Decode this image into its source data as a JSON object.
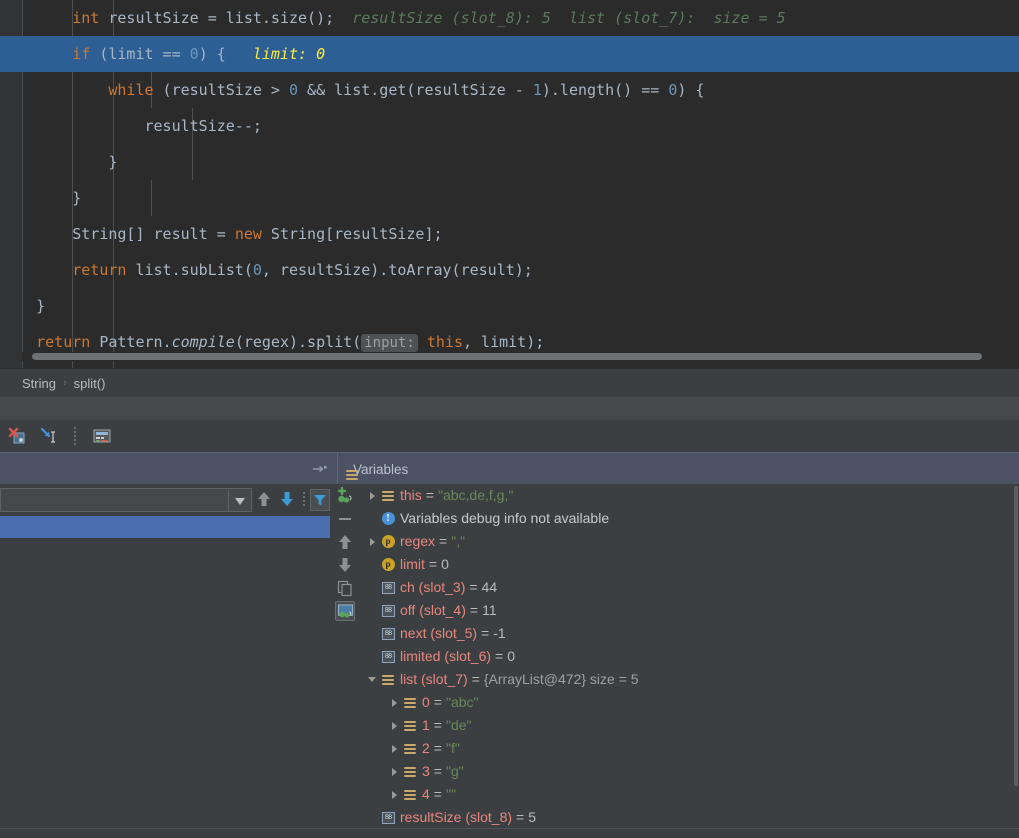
{
  "editor": {
    "lines": [
      {
        "indent": 0,
        "highlighted": false,
        "tokens": [
          {
            "t": "        ",
            "c": "plain"
          },
          {
            "t": "int",
            "c": "kw"
          },
          {
            "t": " resultSize = list.size();",
            "c": "plain"
          },
          {
            "t": "  resultSize (slot_8): 5  list (slot_7):  size = 5",
            "c": "hint-green"
          }
        ]
      },
      {
        "indent": 0,
        "highlighted": true,
        "tokens": [
          {
            "t": "        ",
            "c": "plain"
          },
          {
            "t": "if",
            "c": "kw"
          },
          {
            "t": " (limit == ",
            "c": "plain"
          },
          {
            "t": "0",
            "c": "num"
          },
          {
            "t": ") {",
            "c": "plain"
          },
          {
            "t": "   limit: 0",
            "c": "hint-yellow"
          }
        ]
      },
      {
        "indent": 0,
        "highlighted": false,
        "tokens": [
          {
            "t": "            ",
            "c": "plain"
          },
          {
            "t": "while",
            "c": "kw"
          },
          {
            "t": " (resultSize > ",
            "c": "plain"
          },
          {
            "t": "0",
            "c": "num"
          },
          {
            "t": " && list.get(resultSize - ",
            "c": "plain"
          },
          {
            "t": "1",
            "c": "num"
          },
          {
            "t": ").length() == ",
            "c": "plain"
          },
          {
            "t": "0",
            "c": "num"
          },
          {
            "t": ") {",
            "c": "plain"
          }
        ]
      },
      {
        "indent": 0,
        "highlighted": false,
        "tokens": [
          {
            "t": "                resultSize--;",
            "c": "plain"
          }
        ]
      },
      {
        "indent": 0,
        "highlighted": false,
        "tokens": [
          {
            "t": "            }",
            "c": "plain"
          }
        ]
      },
      {
        "indent": 0,
        "highlighted": false,
        "tokens": [
          {
            "t": "        }",
            "c": "plain"
          }
        ]
      },
      {
        "indent": 0,
        "highlighted": false,
        "tokens": [
          {
            "t": "        String[] result = ",
            "c": "plain"
          },
          {
            "t": "new",
            "c": "kw"
          },
          {
            "t": " String[resultSize];",
            "c": "plain"
          }
        ]
      },
      {
        "indent": 0,
        "highlighted": false,
        "tokens": [
          {
            "t": "        ",
            "c": "plain"
          },
          {
            "t": "return",
            "c": "kw"
          },
          {
            "t": " list.subList(",
            "c": "plain"
          },
          {
            "t": "0",
            "c": "num"
          },
          {
            "t": ", resultSize).toArray(result);",
            "c": "plain"
          }
        ]
      },
      {
        "indent": 0,
        "highlighted": false,
        "tokens": [
          {
            "t": "    }",
            "c": "plain"
          }
        ]
      },
      {
        "indent": 0,
        "highlighted": false,
        "tokens": [
          {
            "t": "    ",
            "c": "plain"
          },
          {
            "t": "return",
            "c": "kw"
          },
          {
            "t": " Pattern.",
            "c": "plain"
          },
          {
            "t": "compile",
            "c": "ital"
          },
          {
            "t": "(regex).split(",
            "c": "plain"
          },
          {
            "t": "input:",
            "c": "pchip"
          },
          {
            "t": " ",
            "c": "plain"
          },
          {
            "t": "this",
            "c": "kw"
          },
          {
            "t": ", limit);",
            "c": "plain"
          }
        ]
      }
    ]
  },
  "breadcrumb": {
    "items": [
      "String",
      "split()"
    ],
    "separator": "›"
  },
  "debug_toolbar": {
    "icons": [
      {
        "name": "mute-breakpoints-icon",
        "title": "Mute Breakpoints"
      },
      {
        "name": "run-to-cursor-icon",
        "title": "Run to Cursor"
      },
      {
        "name": "evaluate-expression-icon",
        "title": "Evaluate Expression"
      }
    ]
  },
  "variables_panel": {
    "tab_label": "Variables",
    "tab_icon": "variables-list-icon",
    "pin_icon": "settings-arrow-icon"
  },
  "left_panel": {
    "combo_value": "",
    "combo_placeholder": "",
    "nav_icons": [
      {
        "name": "nav-up-icon"
      },
      {
        "name": "nav-down-icon"
      },
      {
        "name": "filter-icon",
        "selected": true
      }
    ]
  },
  "vertical_strip": {
    "icons": [
      {
        "name": "add-watch-icon",
        "selected": false
      },
      {
        "name": "remove-watch-icon",
        "selected": false
      },
      {
        "name": "move-up-icon",
        "selected": false
      },
      {
        "name": "move-down-icon",
        "selected": false
      },
      {
        "name": "copy-icon",
        "selected": false
      },
      {
        "name": "watches-toggle-icon",
        "selected": true
      }
    ]
  },
  "variables_tree": [
    {
      "indent": 0,
      "expander": "right",
      "icon": "list-icon",
      "name": "this",
      "eq": "=",
      "value": "\"abc,de,f,g,\"",
      "value_kind": "string"
    },
    {
      "indent": 0,
      "expander": "none",
      "icon": "warning-icon",
      "name": "",
      "eq": "",
      "value": "Variables debug info not available",
      "value_kind": "warning"
    },
    {
      "indent": 0,
      "expander": "right",
      "icon": "param-icon",
      "name": "regex",
      "eq": "=",
      "value": "\",\"",
      "value_kind": "string"
    },
    {
      "indent": 0,
      "expander": "none",
      "icon": "param-icon",
      "name": "limit",
      "eq": "=",
      "value": "0",
      "value_kind": "number"
    },
    {
      "indent": 0,
      "expander": "none",
      "icon": "primitive-icon",
      "name": "ch (slot_3)",
      "eq": "=",
      "value": "44",
      "value_kind": "number"
    },
    {
      "indent": 0,
      "expander": "none",
      "icon": "primitive-icon",
      "name": "off (slot_4)",
      "eq": "=",
      "value": "11",
      "value_kind": "number"
    },
    {
      "indent": 0,
      "expander": "none",
      "icon": "primitive-icon",
      "name": "next (slot_5)",
      "eq": "=",
      "value": "-1",
      "value_kind": "number"
    },
    {
      "indent": 0,
      "expander": "none",
      "icon": "primitive-icon",
      "name": "limited (slot_6)",
      "eq": "=",
      "value": "0",
      "value_kind": "number"
    },
    {
      "indent": 0,
      "expander": "down",
      "icon": "list-icon",
      "name": "list (slot_7)",
      "eq": "=",
      "value": "{ArrayList@472}  size = 5",
      "value_kind": "object"
    },
    {
      "indent": 1,
      "expander": "right",
      "icon": "list-icon",
      "name": "0",
      "eq": "=",
      "value": "\"abc\"",
      "value_kind": "string"
    },
    {
      "indent": 1,
      "expander": "right",
      "icon": "list-icon",
      "name": "1",
      "eq": "=",
      "value": "\"de\"",
      "value_kind": "string"
    },
    {
      "indent": 1,
      "expander": "right",
      "icon": "list-icon",
      "name": "2",
      "eq": "=",
      "value": "\"f\"",
      "value_kind": "string"
    },
    {
      "indent": 1,
      "expander": "right",
      "icon": "list-icon",
      "name": "3",
      "eq": "=",
      "value": "\"g\"",
      "value_kind": "string"
    },
    {
      "indent": 1,
      "expander": "right",
      "icon": "list-icon",
      "name": "4",
      "eq": "=",
      "value": "\"\"",
      "value_kind": "string"
    },
    {
      "indent": 0,
      "expander": "none",
      "icon": "primitive-icon",
      "name": "resultSize (slot_8)",
      "eq": "=",
      "value": "5",
      "value_kind": "number"
    }
  ],
  "colors": {
    "editor_bg": "#2b2b2b",
    "panel_bg": "#3c3f41",
    "highlight_line": "#2d5f94",
    "selection_blue": "#4b6eaf",
    "tabbar_blue": "#4a5263",
    "keyword": "#cc7832",
    "number": "#6897bb",
    "string": "#6a8759",
    "text": "#a9b7c6",
    "hint_green": "#5c7a5c",
    "hint_yellow": "#ffeb3b",
    "var_name": "#e8867d"
  }
}
